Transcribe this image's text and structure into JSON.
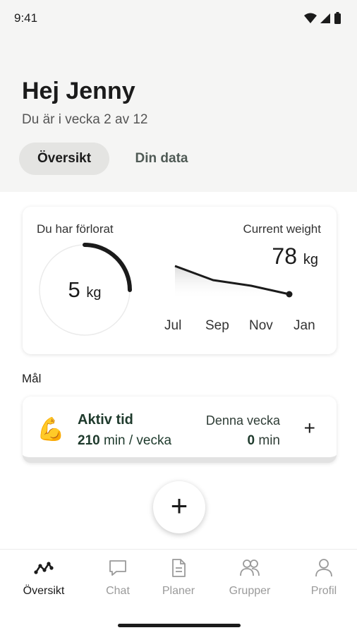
{
  "status_bar": {
    "time": "9:41"
  },
  "header": {
    "greeting": "Hej Jenny",
    "subtitle": "Du är i vecka 2 av 12",
    "tabs": [
      {
        "label": "Översikt",
        "active": true
      },
      {
        "label": "Din data",
        "active": false
      }
    ]
  },
  "weight_card": {
    "lost_label": "Du har förlorat",
    "lost_value": "5",
    "lost_unit": "kg",
    "lost_progress": 0.25,
    "current_label": "Current weight",
    "current_value": "78",
    "current_unit": "kg",
    "chart_data": {
      "type": "line",
      "x": [
        "Jul",
        "Sep",
        "Nov",
        "Jan"
      ],
      "values": [
        83,
        80.5,
        79.5,
        78
      ],
      "ylim": [
        77,
        84
      ]
    }
  },
  "goals": {
    "section_label": "Mål",
    "items": [
      {
        "emoji": "💪",
        "title": "Aktiv tid",
        "target_value": "210",
        "target_unit": "min / vecka",
        "week_label": "Denna vecka",
        "week_value": "0",
        "week_unit": "min",
        "add_symbol": "+"
      }
    ]
  },
  "fab": {
    "symbol": "+"
  },
  "bottom_nav": {
    "items": [
      {
        "label": "Översikt",
        "icon": "trend-icon",
        "active": true
      },
      {
        "label": "Chat",
        "icon": "chat-bubble-icon",
        "active": false
      },
      {
        "label": "Planer",
        "icon": "document-icon",
        "active": false
      },
      {
        "label": "Grupper",
        "icon": "group-icon",
        "active": false
      },
      {
        "label": "Profil",
        "icon": "person-icon",
        "active": false
      }
    ]
  },
  "colors": {
    "header_bg": "#f5f5f4",
    "accent_dark_green": "#1e3a2c",
    "inactive_nav": "#9a9a9a"
  }
}
